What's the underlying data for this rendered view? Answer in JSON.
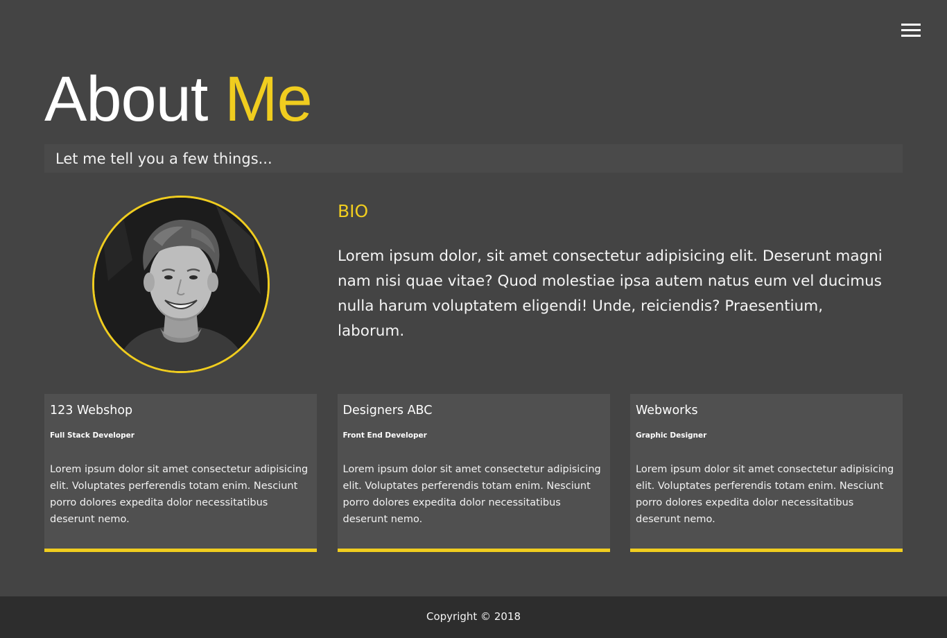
{
  "nav": {
    "menu_icon": "hamburger-menu-icon"
  },
  "header": {
    "title_main": "About",
    "title_accent": "Me",
    "lead": "Let me tell you a few things..."
  },
  "bio": {
    "title": "BIO",
    "text": "Lorem ipsum dolor, sit amet consectetur adipisicing elit. Deserunt magni nam nisi quae vitae? Quod molestiae ipsa autem natus eum vel ducimus nulla harum voluptatem eligendi! Unde, reiciendis? Praesentium, laborum."
  },
  "jobs": [
    {
      "company": "123 Webshop",
      "role": "Full Stack Developer",
      "description": "Lorem ipsum dolor sit amet consectetur adipisicing elit. Voluptates perferendis totam enim. Nesciunt porro dolores expedita dolor necessitatibus deserunt nemo."
    },
    {
      "company": "Designers ABC",
      "role": "Front End Developer",
      "description": "Lorem ipsum dolor sit amet consectetur adipisicing elit. Voluptates perferendis totam enim. Nesciunt porro dolores expedita dolor necessitatibus deserunt nemo."
    },
    {
      "company": "Webworks",
      "role": "Graphic Designer",
      "description": "Lorem ipsum dolor sit amet consectetur adipisicing elit. Voluptates perferendis totam enim. Nesciunt porro dolores expedita dolor necessitatibus deserunt nemo."
    }
  ],
  "footer": {
    "copyright": "Copyright © 2018"
  },
  "colors": {
    "background": "#444444",
    "accent": "#f0cd1f",
    "card": "#505050",
    "footer": "#2d2d2d"
  }
}
